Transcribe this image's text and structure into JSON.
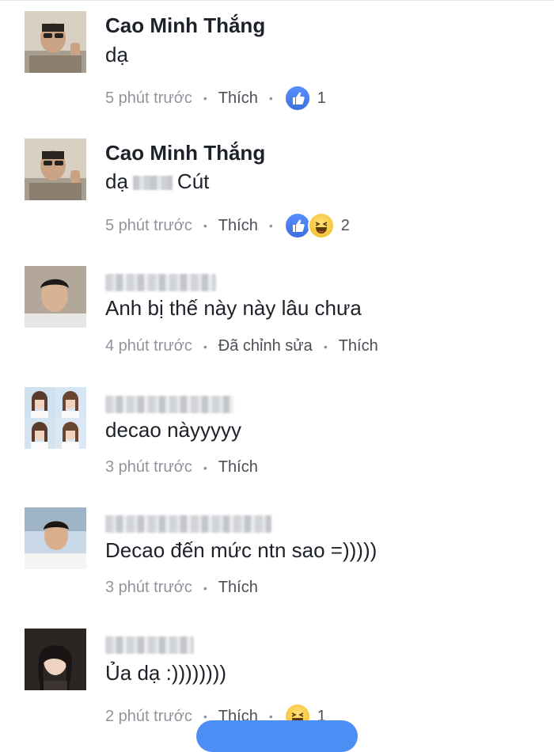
{
  "comments": [
    {
      "name": "Cao Minh Thắng",
      "text_before": "dạ",
      "text_after": "",
      "time": "5 phút trước",
      "like_label": "Thích",
      "reactions": [
        "like"
      ],
      "reaction_count": "1"
    },
    {
      "name": "Cao Minh Thắng",
      "text_before": "dạ",
      "text_after": "Cút",
      "time": "5 phút trước",
      "like_label": "Thích",
      "reactions": [
        "like",
        "haha"
      ],
      "reaction_count": "2"
    },
    {
      "name": "",
      "text_before": "Anh bị thế này này lâu chưa",
      "time": "4 phút trước",
      "edited_label": "Đã chỉnh sửa",
      "like_label": "Thích"
    },
    {
      "name": "",
      "text_before": "decao nàyyyyy",
      "time": "3 phút trước",
      "like_label": "Thích"
    },
    {
      "name": "",
      "text_before": "Decao đến mức ntn sao =)))))",
      "time": "3 phút trước",
      "like_label": "Thích"
    },
    {
      "name": "",
      "text_before": "Ủa dạ :))))))))",
      "time": "2 phút trước",
      "like_label": "Thích",
      "reactions": [
        "haha"
      ],
      "reaction_count": "1"
    }
  ],
  "colors": {
    "name": "#1d2129",
    "meta": "#90949c",
    "like_blue": "#3b6fe0",
    "haha_yellow": "#f7c93b"
  }
}
